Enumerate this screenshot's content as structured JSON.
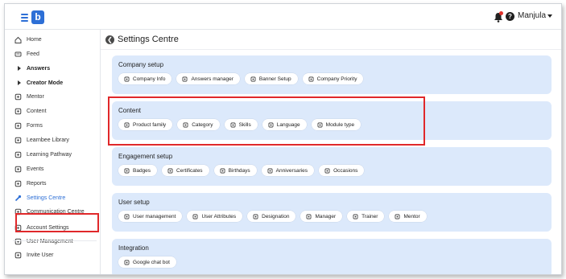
{
  "header": {
    "logo_letter": "b",
    "user_name": "Manjula"
  },
  "sidebar": {
    "items": [
      {
        "label": "Home",
        "icon": "home-icon",
        "kind": "link"
      },
      {
        "label": "Feed",
        "icon": "feed-icon",
        "kind": "link"
      },
      {
        "label": "Answers",
        "icon": "triangle-right-icon",
        "kind": "group"
      },
      {
        "label": "Creator Mode",
        "icon": "triangle-right-icon",
        "kind": "group"
      },
      {
        "label": "Mentor",
        "icon": "mentor-icon",
        "kind": "link"
      },
      {
        "label": "Content",
        "icon": "content-icon",
        "kind": "link"
      },
      {
        "label": "Forms",
        "icon": "forms-icon",
        "kind": "link"
      },
      {
        "label": "Learnbee Library",
        "icon": "library-icon",
        "kind": "link"
      },
      {
        "label": "Learning Pathway",
        "icon": "pathway-icon",
        "kind": "link"
      },
      {
        "label": "Events",
        "icon": "events-icon",
        "kind": "link"
      },
      {
        "label": "Reports",
        "icon": "reports-icon",
        "kind": "link"
      },
      {
        "label": "Settings Centre",
        "icon": "settings-icon",
        "kind": "active"
      },
      {
        "label": "Communication Centre",
        "icon": "communication-icon",
        "kind": "link"
      },
      {
        "label": "Account Settings",
        "icon": "account-settings-icon",
        "kind": "link"
      },
      {
        "label": "User Management",
        "icon": "user-management-icon",
        "kind": "link"
      },
      {
        "label": "Invite User",
        "icon": "invite-user-icon",
        "kind": "link"
      }
    ]
  },
  "main": {
    "title": "Settings Centre",
    "sections": [
      {
        "title": "Company setup",
        "chips": [
          {
            "label": "Company Info",
            "icon": "company-info-icon"
          },
          {
            "label": "Answers manager",
            "icon": "grid-icon"
          },
          {
            "label": "Banner Setup",
            "icon": "banner-icon"
          },
          {
            "label": "Company Priority",
            "icon": "priority-icon"
          }
        ]
      },
      {
        "title": "Content",
        "chips": [
          {
            "label": "Product family",
            "icon": "product-family-icon"
          },
          {
            "label": "Category",
            "icon": "category-icon"
          },
          {
            "label": "Skills",
            "icon": "skills-icon"
          },
          {
            "label": "Language",
            "icon": "language-icon"
          },
          {
            "label": "Module type",
            "icon": "module-type-icon"
          }
        ]
      },
      {
        "title": "Engagement setup",
        "chips": [
          {
            "label": "Badges",
            "icon": "badge-icon"
          },
          {
            "label": "Certificates",
            "icon": "certificate-icon"
          },
          {
            "label": "Birthdays",
            "icon": "birthday-icon"
          },
          {
            "label": "Anniversaries",
            "icon": "anniversary-icon"
          },
          {
            "label": "Occasions",
            "icon": "occasion-icon"
          }
        ]
      },
      {
        "title": "User setup",
        "chips": [
          {
            "label": "User management",
            "icon": "user-management-icon"
          },
          {
            "label": "User Attributes",
            "icon": "user-attributes-icon"
          },
          {
            "label": "Designation",
            "icon": "designation-icon"
          },
          {
            "label": "Manager",
            "icon": "manager-icon"
          },
          {
            "label": "Trainer",
            "icon": "trainer-icon"
          },
          {
            "label": "Mentor",
            "icon": "mentor-icon"
          }
        ]
      },
      {
        "title": "Integration",
        "chips": [
          {
            "label": "Google chat bot",
            "icon": "chat-bot-icon"
          }
        ]
      }
    ]
  },
  "colors": {
    "accent": "#2d6fd6",
    "card_bg": "#dce9fb",
    "highlight_red": "#e0282a"
  }
}
